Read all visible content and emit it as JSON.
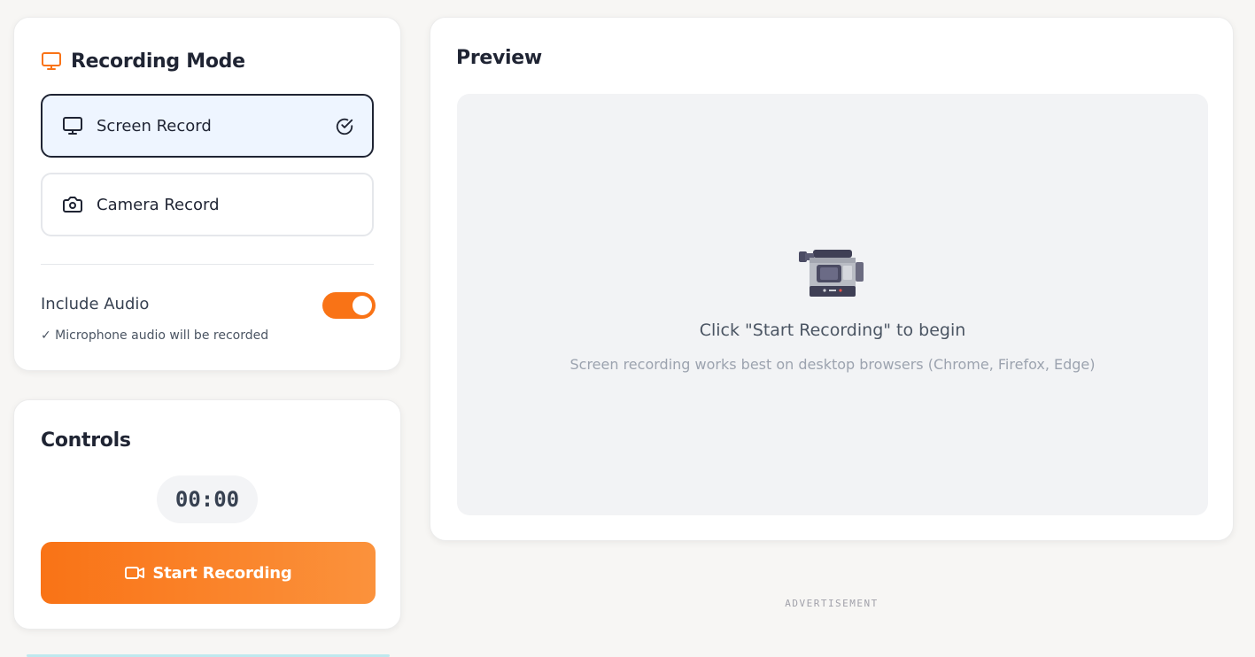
{
  "recording_mode": {
    "title": "Recording Mode",
    "icon": "monitor-icon",
    "options": [
      {
        "label": "Screen Record",
        "icon": "monitor-icon",
        "selected": true
      },
      {
        "label": "Camera Record",
        "icon": "camera-icon",
        "selected": false
      }
    ],
    "audio": {
      "label": "Include Audio",
      "enabled": true,
      "note": "✓ Microphone audio will be recorded"
    }
  },
  "controls": {
    "title": "Controls",
    "timer": "00:00",
    "start_label": "Start Recording",
    "start_icon": "video-camera-icon"
  },
  "preview": {
    "title": "Preview",
    "main_text": "Click \"Start Recording\" to begin",
    "sub_text": "Screen recording works best on desktop browsers (Chrome, Firefox, Edge)",
    "illustration": "video-camera-illustration"
  },
  "advertisement_label": "ADVERTISEMENT",
  "colors": {
    "accent": "#f97316",
    "accent_light": "#fb923c",
    "selected_bg": "#eef5ff",
    "text_dark": "#1f2433",
    "preview_bg": "#f2f3f5"
  }
}
